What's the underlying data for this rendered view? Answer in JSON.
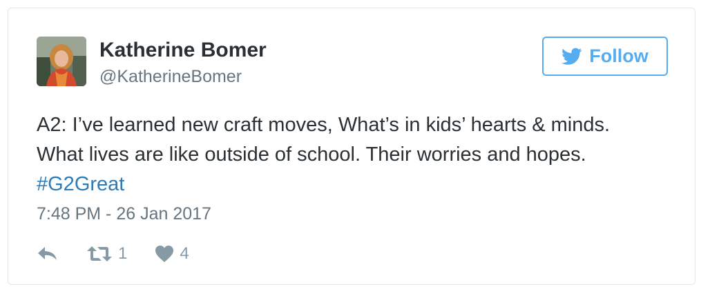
{
  "user": {
    "name": "Katherine Bomer",
    "handle": "@KatherineBomer"
  },
  "follow_button": {
    "label": "Follow",
    "icon": "twitter-bird-icon"
  },
  "tweet": {
    "text_line1": "A2: I’ve learned new craft moves, What’s in kids’ hearts & minds.",
    "text_line2": "What lives are like outside of school. Their worries and hopes.",
    "hashtag": "#G2Great",
    "timestamp": "7:48 PM - 26 Jan 2017"
  },
  "actions": {
    "reply_icon": "reply-icon",
    "retweet_icon": "retweet-icon",
    "retweet_count": "1",
    "like_icon": "heart-icon",
    "like_count": "4"
  },
  "colors": {
    "accent": "#55acee",
    "hashtag": "#2b7bb9",
    "text": "#292f33",
    "muted": "#66757f",
    "action": "#8899a6"
  }
}
